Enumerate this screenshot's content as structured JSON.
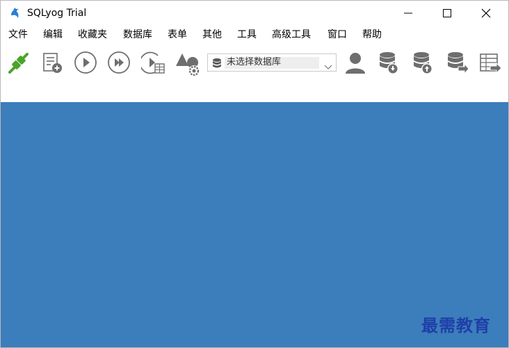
{
  "window": {
    "title": "SQLyog Trial",
    "controls": [
      "minimize",
      "maximize",
      "close"
    ]
  },
  "menu": {
    "items": [
      "文件",
      "编辑",
      "收藏夹",
      "数据库",
      "表单",
      "其他",
      "工具",
      "高级工具",
      "窗口",
      "帮助"
    ]
  },
  "toolbar": {
    "buttons": [
      {
        "icon": "connect-icon"
      },
      {
        "icon": "new-query-icon"
      },
      {
        "icon": "execute-query-icon"
      },
      {
        "icon": "execute-all-icon"
      },
      {
        "icon": "execute-query-grid-icon"
      },
      {
        "icon": "schema-designer-icon"
      }
    ],
    "database_select": {
      "value": "未选择数据库"
    },
    "right_buttons": [
      {
        "icon": "user-manager-icon"
      },
      {
        "icon": "backup-database-icon"
      },
      {
        "icon": "restore-database-icon"
      },
      {
        "icon": "copy-database-icon"
      },
      {
        "icon": "import-table-icon"
      }
    ]
  },
  "colors": {
    "main_area": "#3c7dbb",
    "connect_icon": "#4ba32b",
    "toolbar_icon": "#6e6e6e",
    "watermark": "#1f3fa8"
  },
  "watermark": {
    "text": "最需教育"
  }
}
